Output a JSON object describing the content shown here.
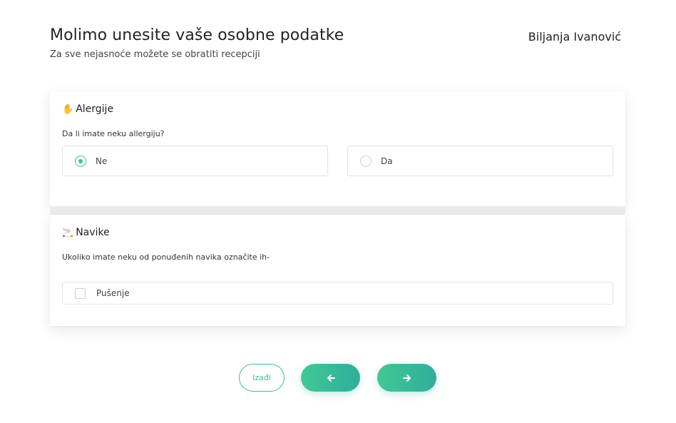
{
  "header": {
    "title": "Molimo unesite vaše osobne podatke",
    "subtitle": "Za sve nejasnoće možete se obratiti recepciji",
    "user_name": "Biljanja Ivanović"
  },
  "allergies": {
    "icon": "raised-hand-icon",
    "icon_glyph": "✋",
    "title": "Alergije",
    "question": "Da li imate neku allergiju?",
    "options": [
      {
        "label": "Ne",
        "selected": true
      },
      {
        "label": "Da",
        "selected": false
      }
    ]
  },
  "habits": {
    "icon": "cigarette-icon",
    "icon_glyph": "🚬",
    "title": "Navike",
    "question": "Ukoliko imate neku od ponuđenih navika označite ih-",
    "options": [
      {
        "label": "Pušenje",
        "checked": false
      }
    ]
  },
  "footer": {
    "exit_label": "Izađi",
    "back_icon": "arrow-left-icon",
    "next_icon": "arrow-right-icon"
  },
  "colors": {
    "accent": "#3dbf93",
    "accent_dark": "#2fae9b"
  }
}
